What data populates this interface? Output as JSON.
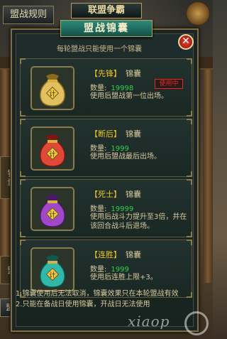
{
  "header": {
    "rules_button": "盟战规则",
    "title": "联盟争霸"
  },
  "side_tabs": {
    "upper": "锦囊",
    "lower": "盟"
  },
  "bottom_left_button": "盟",
  "panel": {
    "title": "盟战锦囊",
    "close_label": "✕",
    "subtitle": "每轮盟战只能使用一个锦囊"
  },
  "items": [
    {
      "tag": "【先锋】",
      "kind": "锦囊",
      "qty_label": "数量:",
      "qty": "19998",
      "desc": "使用后盟战第一位出场。",
      "in_use": "使用中",
      "bag_color": "#e0c060",
      "bag_dark": "#8a6a20"
    },
    {
      "tag": "【断后】",
      "kind": "锦囊",
      "qty_label": "数量:",
      "qty": "1999",
      "desc": "使用后盟战最后出场。",
      "in_use": "",
      "bag_color": "#e04838",
      "bag_dark": "#7a1810"
    },
    {
      "tag": "【死士】",
      "kind": "锦囊",
      "qty_label": "数量:",
      "qty": "19999",
      "desc": "使用后战斗力提升至3倍，并在该回合战斗后退场。",
      "in_use": "",
      "bag_color": "#a048c8",
      "bag_dark": "#4a1868"
    },
    {
      "tag": "【连胜】",
      "kind": "锦囊",
      "qty_label": "数量:",
      "qty": "1999",
      "desc": "使用后连胜上限+3。",
      "in_use": "",
      "bag_color": "#30b8a8",
      "bag_dark": "#105850"
    }
  ],
  "notes": [
    "1.锦囊使用后无法取消，锦囊效果只在本轮盟战有效",
    "2.只能在备战日使用锦囊，开战日无法使用"
  ],
  "watermark": "xiaop"
}
